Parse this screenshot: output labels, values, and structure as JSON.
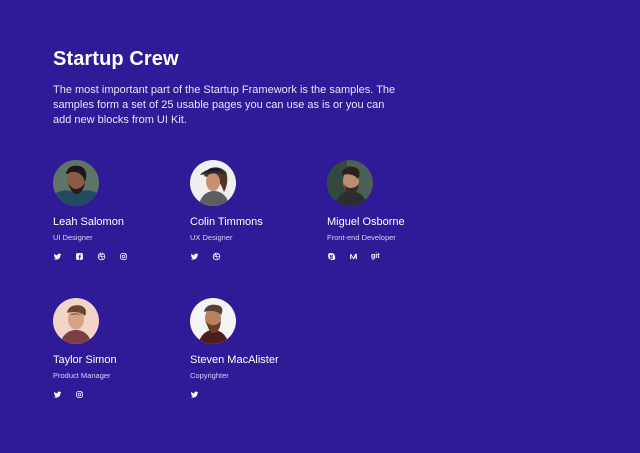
{
  "section": {
    "title": "Startup Crew",
    "description": "The most important part of the Startup Framework is the samples. The samples form a set of 25 usable pages you can use as is or you can add new blocks from UI Kit."
  },
  "members": [
    {
      "name": "Leah Salomon",
      "role": "UI Designer",
      "socials": [
        "twitter-icon",
        "facebook-icon",
        "dribbble-icon",
        "instagram-icon"
      ]
    },
    {
      "name": "Colin Timmons",
      "role": "UX Designer",
      "socials": [
        "twitter-icon",
        "dribbble-icon"
      ]
    },
    {
      "name": "Miguel Osborne",
      "role": "Front-end Developer",
      "socials": [
        "skype-icon",
        "medium-icon",
        "git-icon"
      ],
      "git_label": "git"
    },
    {
      "name": "Taylor Simon",
      "role": "Product Manager",
      "socials": [
        "twitter-icon",
        "instagram-icon"
      ]
    },
    {
      "name": "Steven MacAlister",
      "role": "Copyrighter",
      "socials": [
        "twitter-icon"
      ]
    }
  ],
  "colors": {
    "background": "#2f1a97",
    "text": "#ffffff",
    "muted_text": "#d8d3f6"
  }
}
